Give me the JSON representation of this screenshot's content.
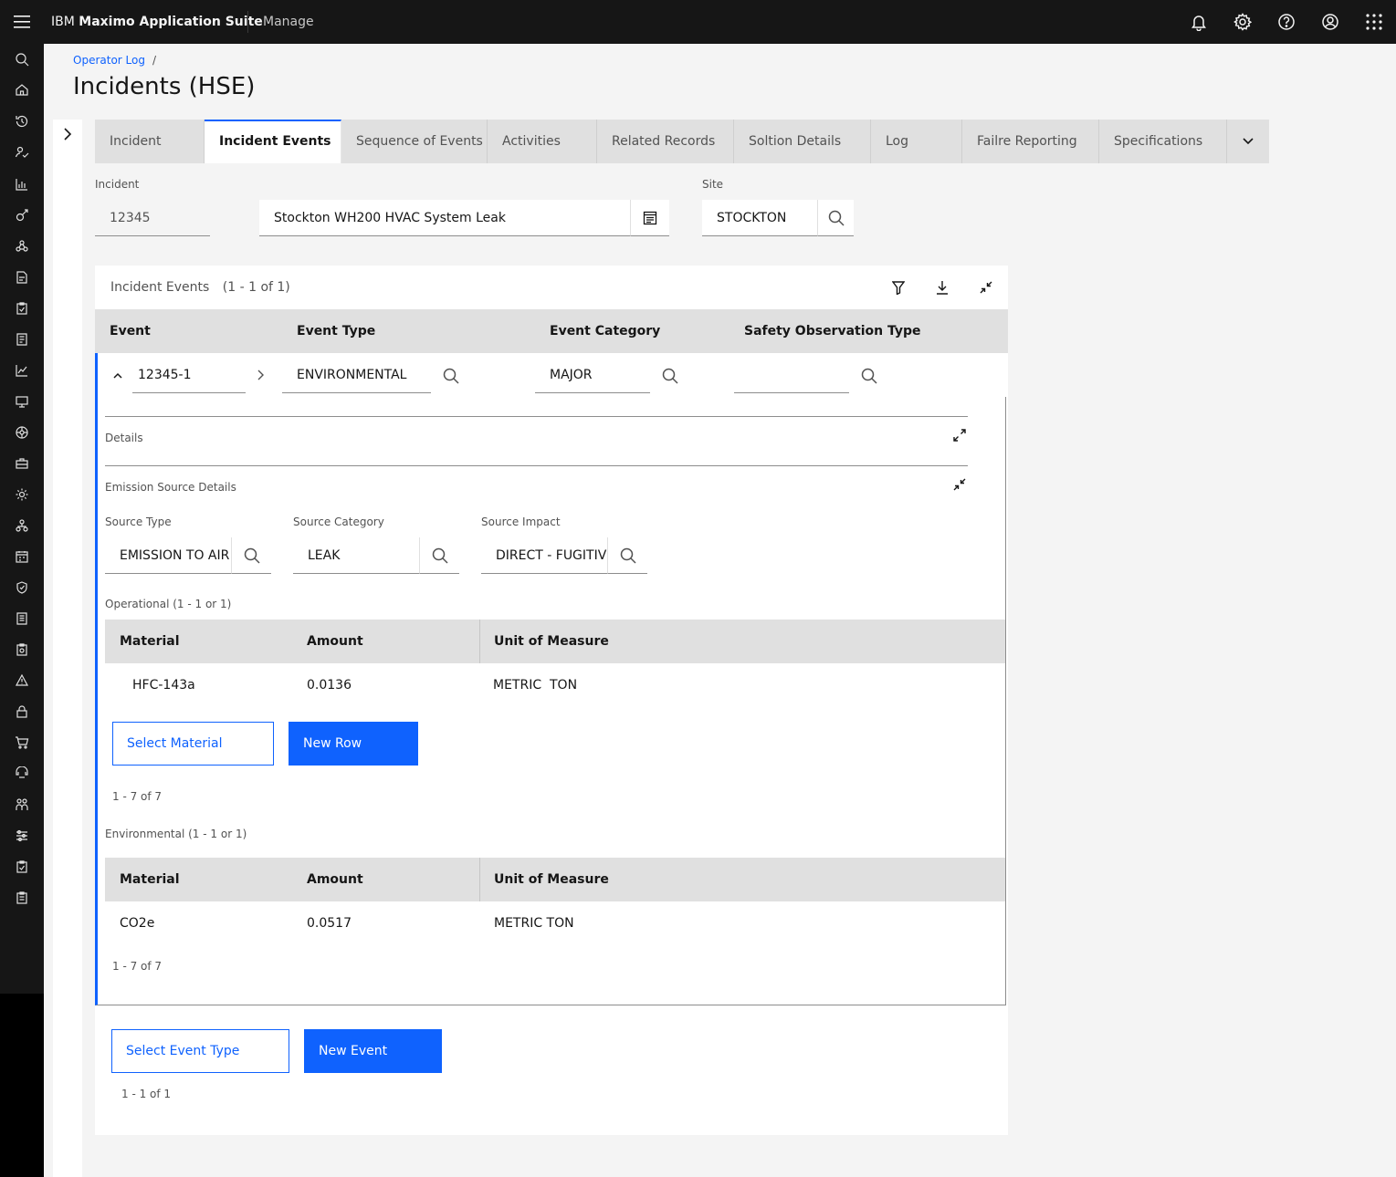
{
  "header": {
    "brand_prefix": "IBM",
    "brand_name": "Maximo Application Suite",
    "app_name": "Manage",
    "icons": [
      "menu-icon",
      "notification-icon",
      "settings-icon",
      "help-icon",
      "user-avatar-icon",
      "app-switcher-icon"
    ]
  },
  "sidenav": {
    "icons": [
      "search-icon",
      "home-icon",
      "history-icon",
      "user-check-icon",
      "chart-bar-icon",
      "asset-icon",
      "network-icon",
      "work-order-icon",
      "inspection-icon",
      "report-icon",
      "trend-icon",
      "monitor-icon",
      "settings-wheel-icon",
      "toolbox-icon",
      "gear-icon",
      "hierarchy-icon",
      "calendar-icon",
      "shield-icon",
      "document-icon",
      "clipboard-icon",
      "warning-icon",
      "lock-icon",
      "cart-icon",
      "service-icon",
      "people-icon",
      "sliders-icon",
      "checklist-icon",
      "list-icon"
    ]
  },
  "breadcrumb": {
    "item": "Operator Log",
    "separator": "/"
  },
  "page": {
    "title": "Incidents (HSE)"
  },
  "tabs": [
    {
      "label": "Incident"
    },
    {
      "label": "Incident Events"
    },
    {
      "label": "Sequence of Events"
    },
    {
      "label": "Activities"
    },
    {
      "label": "Related Records"
    },
    {
      "label": "Soltion Details"
    },
    {
      "label": "Log"
    },
    {
      "label": "Failre Reporting"
    },
    {
      "label": "Specifications"
    }
  ],
  "active_tab": "Incident Events",
  "incident": {
    "label": "Incident",
    "id": "12345",
    "description": "Stockton WH200 HVAC System Leak",
    "site_label": "Site",
    "site": "STOCKTON"
  },
  "events_table": {
    "title": "Incident Events",
    "count": "(1 - 1 of 1)",
    "columns": [
      "Event",
      "Event Type",
      "Event Category",
      "Safety Observation Type"
    ],
    "row": {
      "event": "12345-1",
      "event_type": "ENVIRONMENTAL",
      "event_category": "MAJOR",
      "safety_observation_type": ""
    }
  },
  "details": {
    "details_label": "Details",
    "emission_label": "Emission Source Details",
    "source_type_label": "Source Type",
    "source_type": "EMISSION TO AIR",
    "source_category_label": "Source Category",
    "source_category": "LEAK",
    "source_impact_label": "Source Impact",
    "source_impact": "DIRECT - FUGITIVE"
  },
  "operational": {
    "title": "Operational (1 - 1 or 1)",
    "columns": [
      "Material",
      "Amount",
      "Unit of Measure"
    ],
    "rows": [
      {
        "material": "HFC-143a",
        "amount": "0.0136",
        "uom": "METRIC  TON"
      }
    ],
    "select_button": "Select Material",
    "new_button": "New Row",
    "pagination": "1 - 7 of 7"
  },
  "environmental": {
    "title": "Environmental (1 - 1 or 1)",
    "columns": [
      "Material",
      "Amount",
      "Unit of Measure"
    ],
    "rows": [
      {
        "material": "CO2e",
        "amount": "0.0517",
        "uom": "METRIC TON"
      }
    ],
    "pagination": "1 - 7 of 7"
  },
  "footer": {
    "select_event_button": "Select Event Type",
    "new_event_button": "New Event",
    "pagination": "1 - 1 of 1"
  },
  "colors": {
    "accent": "#0f62fe",
    "topbar": "#161616",
    "header_row": "#e0e0e0"
  }
}
